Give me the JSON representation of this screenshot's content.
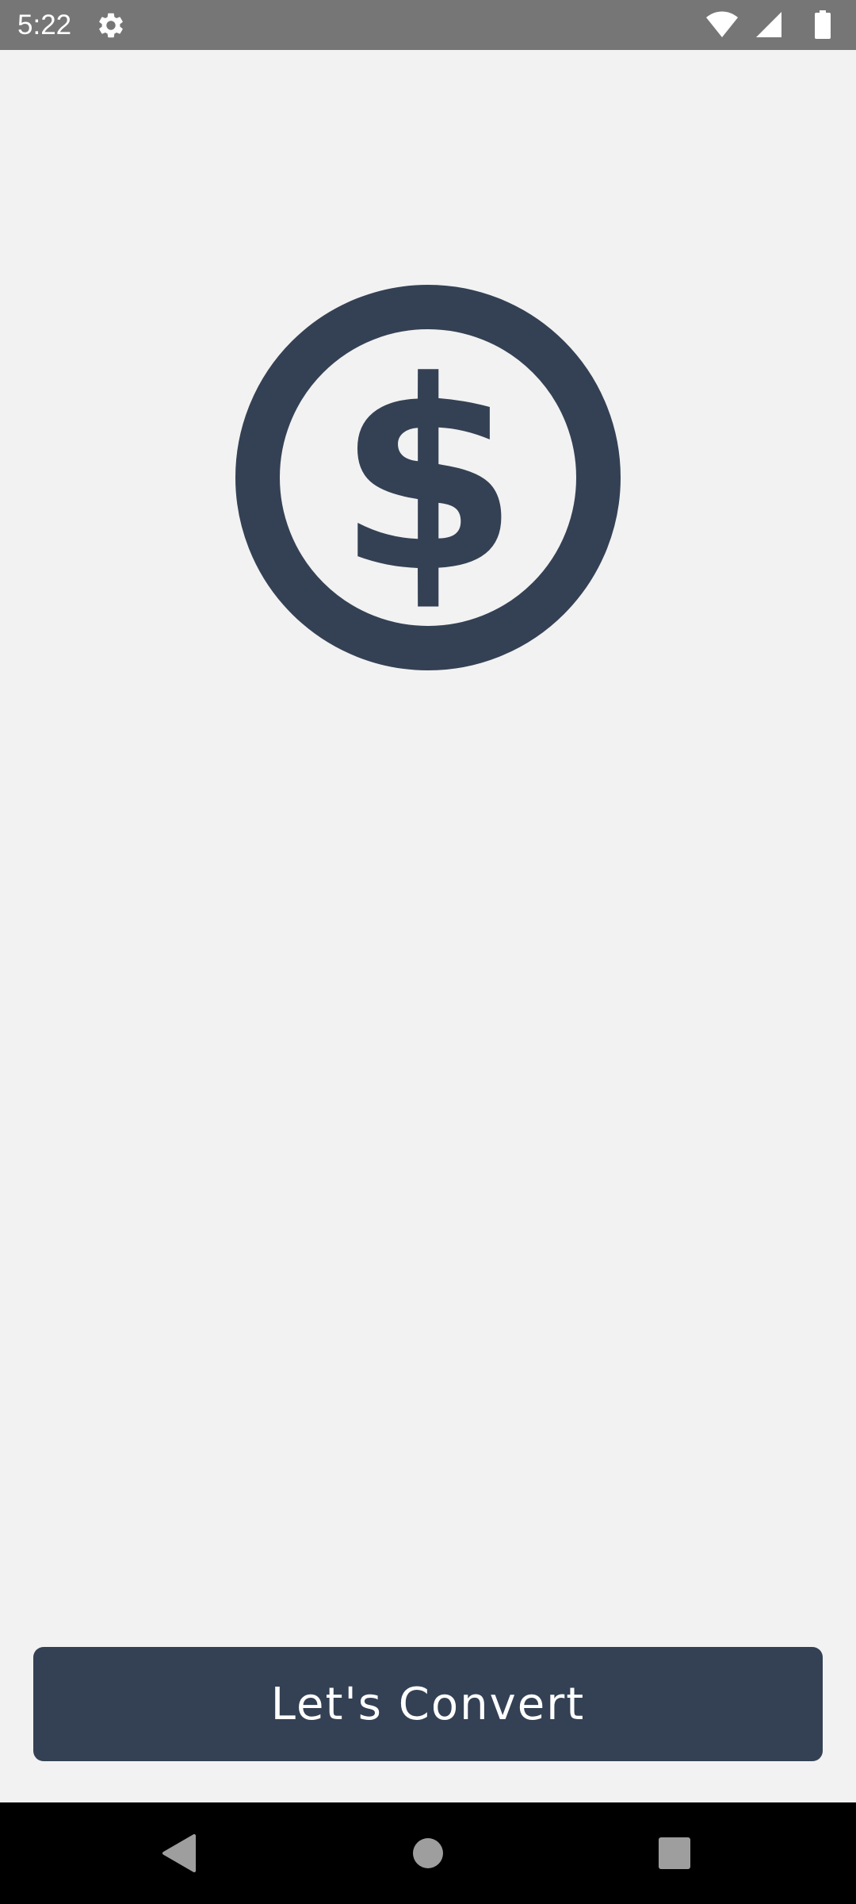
{
  "status_bar": {
    "time": "5:22",
    "icons": [
      "gear-icon",
      "wifi-icon",
      "cellular-signal-icon",
      "battery-icon"
    ]
  },
  "logo": {
    "icon": "dollar-coin-icon",
    "color": "#344154"
  },
  "main": {
    "primary_button_label": "Let's Convert"
  },
  "nav_bar": {
    "buttons": [
      "back-icon",
      "home-icon",
      "recents-icon"
    ]
  },
  "colors": {
    "background": "#f2f2f2",
    "accent": "#344154",
    "status_bar": "#767676",
    "nav_bar": "#000000"
  }
}
